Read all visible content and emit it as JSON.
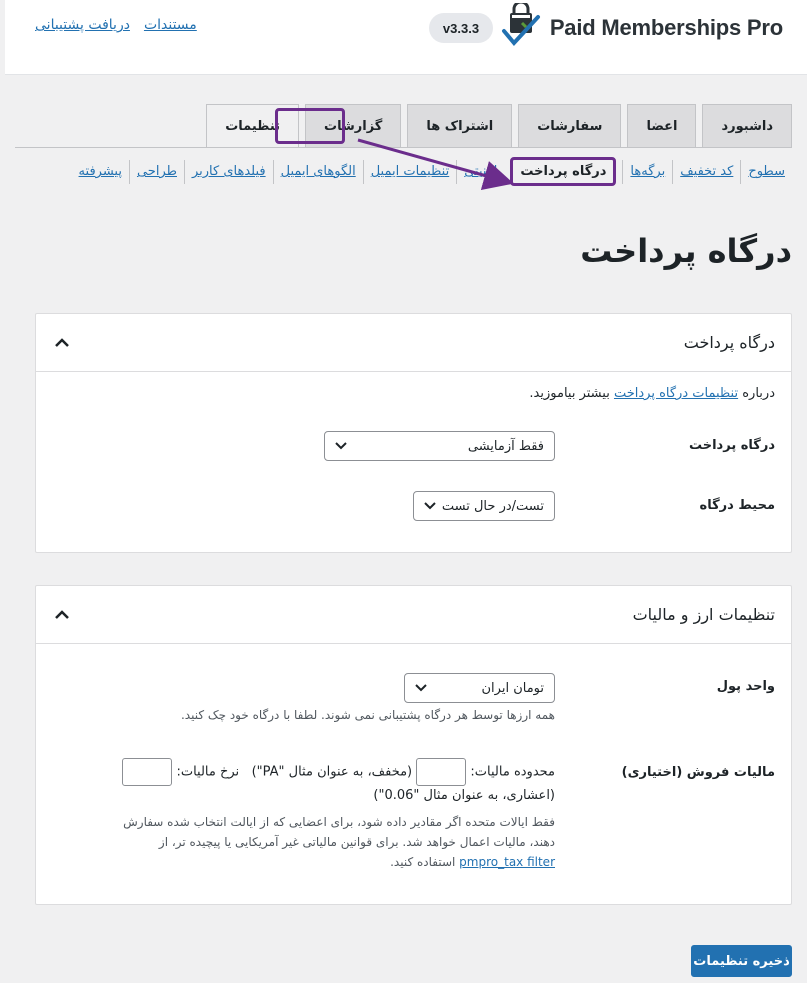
{
  "header": {
    "brand": "Paid Memberships Pro",
    "version": "v3.3.3",
    "links": [
      "مستندات",
      "دریافت پشتیبانی"
    ]
  },
  "tabs": [
    {
      "label": "داشبورد",
      "active": false
    },
    {
      "label": "اعضا",
      "active": false
    },
    {
      "label": "سفارشات",
      "active": false
    },
    {
      "label": "اشتراک ها",
      "active": false
    },
    {
      "label": "گزارشات",
      "active": false
    },
    {
      "label": "تنظیمات",
      "active": true
    }
  ],
  "subnav": [
    {
      "label": "سطوح",
      "current": false
    },
    {
      "label": "کد تخفیف",
      "current": false
    },
    {
      "label": "برگه‌ها",
      "current": false
    },
    {
      "label": "درگاه پرداخت",
      "current": true
    },
    {
      "label": "امنیتی",
      "current": false
    },
    {
      "label": "تنظیمات ایمیل",
      "current": false
    },
    {
      "label": "الگوهای ایمیل",
      "current": false
    },
    {
      "label": "فیلدهای کاربر",
      "current": false
    },
    {
      "label": "طراحی",
      "current": false
    },
    {
      "label": "پیشرفته",
      "current": false
    }
  ],
  "page_title": "درگاه پرداخت",
  "gateway_box": {
    "title": "درگاه پرداخت",
    "intro_prefix": "درباره",
    "intro_link": "تنظیمات درگاه پرداخت",
    "intro_suffix": "بیشتر بیاموزید.",
    "gateway_label": "درگاه پرداخت",
    "gateway_value": "فقط آزمایشی",
    "environment_label": "محیط درگاه",
    "environment_value": "تست/در حال تست"
  },
  "currency_box": {
    "title": "تنظیمات ارز و مالیات",
    "currency_label": "واحد پول",
    "currency_value": "تومان ایران",
    "currency_help": "همه ارزها توسط هر درگاه پشتیبانی نمی شوند. لطفا با درگاه خود چک کنید.",
    "tax_label": "مالیات فروش (اختیاری)",
    "tax_state_label": "محدوده مالیات:",
    "tax_state_hint": "(مخفف، به عنوان مثال \"PA\")",
    "tax_rate_label": "نرخ مالیات:",
    "tax_rate_hint": "(اعشاری، به عنوان مثال \"0.06\")",
    "tax_help_1": "فقط ایالات متحده اگر مقادیر داده شود، برای اعضایی که از ایالت انتخاب شده سفارش",
    "tax_help_2": "دهند، مالیات اعمال خواهد شد. برای قوانین مالیاتی غیر آمریکایی یا پیچیده تر، از",
    "tax_help_link": "pmpro_tax filter",
    "tax_help_3": "استفاده کنید."
  },
  "save_label": "ذخیره تنظیمات",
  "colors": {
    "accent": "#2271b1",
    "highlight": "#6b2d8c"
  }
}
